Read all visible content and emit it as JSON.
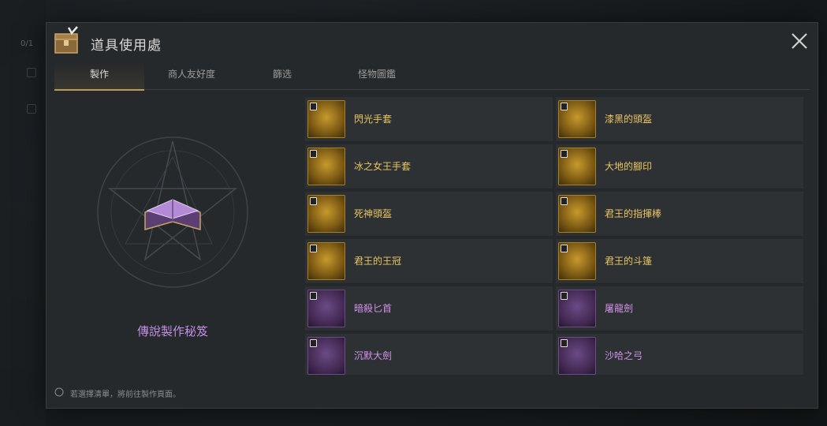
{
  "side": {
    "counter": "0/1"
  },
  "window": {
    "title": "道具使用處",
    "close_label": "✕",
    "chest_icon": "chest-icon"
  },
  "tabs": [
    {
      "label": "製作",
      "active": true
    },
    {
      "label": "商人友好度",
      "active": false
    },
    {
      "label": "篩选",
      "active": false
    },
    {
      "label": "怪物圖鑑",
      "active": false
    }
  ],
  "featured": {
    "name": "傳說製作秘笈",
    "color": "#c28ee3"
  },
  "items": [
    {
      "name": "閃光手套",
      "rarity": "gold",
      "icon": "gauntlet-icon"
    },
    {
      "name": "漆黑的頭盔",
      "rarity": "gold",
      "icon": "helmet-icon"
    },
    {
      "name": "冰之女王手套",
      "rarity": "gold",
      "icon": "ice-glove-icon"
    },
    {
      "name": "大地的腳印",
      "rarity": "gold",
      "icon": "boots-icon"
    },
    {
      "name": "死神頭盔",
      "rarity": "gold",
      "icon": "reaper-helmet-icon"
    },
    {
      "name": "君王的指揮棒",
      "rarity": "gold",
      "icon": "baton-icon"
    },
    {
      "name": "君王的王冠",
      "rarity": "gold",
      "icon": "crown-icon"
    },
    {
      "name": "君王的斗篷",
      "rarity": "gold",
      "icon": "cloak-icon"
    },
    {
      "name": "暗殺匕首",
      "rarity": "purple",
      "icon": "dagger-icon"
    },
    {
      "name": "屠龍劍",
      "rarity": "purple",
      "icon": "dragon-sword-icon"
    },
    {
      "name": "沉默大劍",
      "rarity": "purple",
      "icon": "greatsword-icon"
    },
    {
      "name": "沙哈之弓",
      "rarity": "purple",
      "icon": "bow-icon"
    }
  ],
  "footer": {
    "hint": "若選擇清單，將前往製作頁面。"
  },
  "colors": {
    "gold": "#e9c664",
    "purple": "#cf93ea",
    "tab_accent": "#b99a5b"
  }
}
